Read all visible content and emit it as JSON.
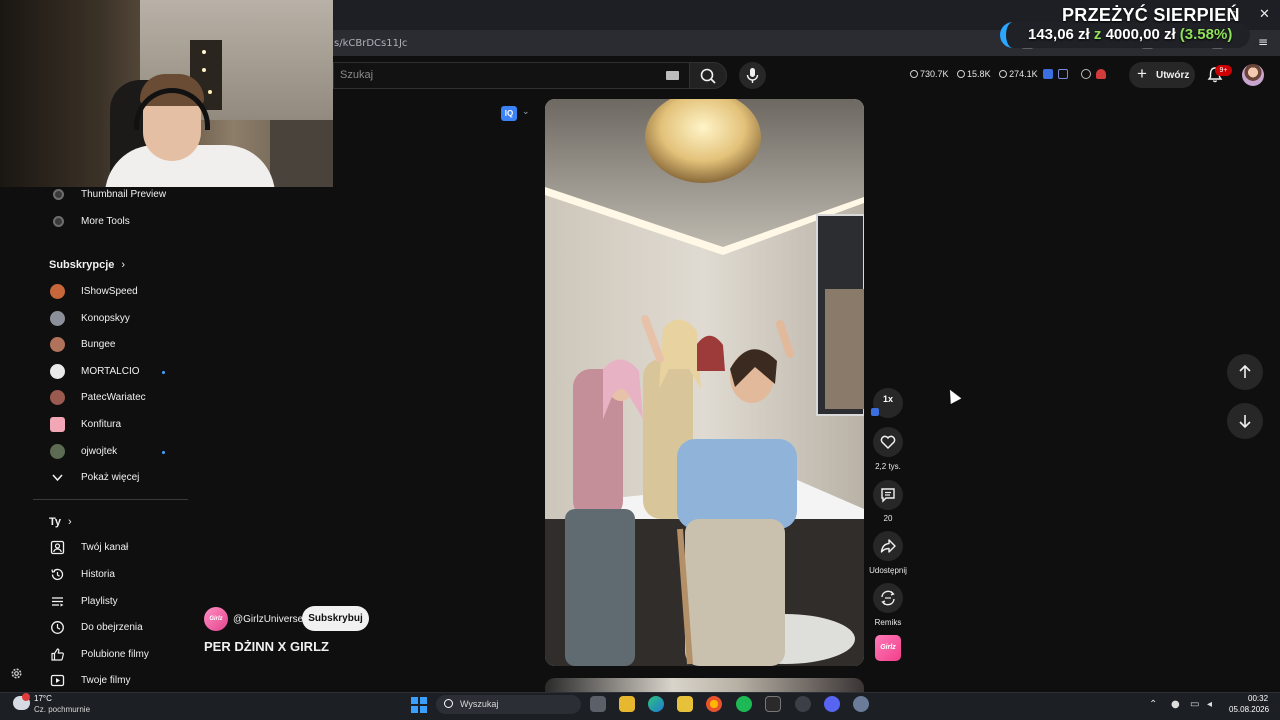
{
  "browser": {
    "url_fragment": "s/kCBrDCs11Jc",
    "minimize": "▢",
    "close": "✕"
  },
  "promo": {
    "title": "PRZEŻYĆ SIERPIEŃ",
    "amount": "143,06 zł",
    "connector": "z",
    "goal": "4000,00 zł",
    "percent": "(3.58%)"
  },
  "header": {
    "search_placeholder": "Szukaj",
    "stats": [
      "730.7K",
      "15.8K",
      "274.1K"
    ],
    "create_label": "Utwórz",
    "notification_count": "9+"
  },
  "sidebar": {
    "tools": [
      {
        "label": "Thumbnail Preview"
      },
      {
        "label": "More Tools"
      }
    ],
    "subscriptions_title": "Subskrypcje",
    "subscriptions": [
      {
        "label": "IShowSpeed",
        "color": "#c8663b",
        "new": false
      },
      {
        "label": "Konopskyy",
        "color": "#8a8f99",
        "new": false
      },
      {
        "label": "Bungee",
        "color": "#b0725a",
        "new": false
      },
      {
        "label": "MORTALCIO",
        "color": "#e9e9e9",
        "new": true
      },
      {
        "label": "PatecWariatec",
        "color": "#9b5a4f",
        "new": false
      },
      {
        "label": "Konfitura",
        "color": "#f2a7b7",
        "new": false
      },
      {
        "label": "ojwojtek",
        "color": "#5d6b52",
        "new": true
      }
    ],
    "show_more": "Pokaż więcej",
    "you_title": "Ty",
    "you_items": [
      {
        "label": "Twój kanał",
        "icon": "person-box-icon"
      },
      {
        "label": "Historia",
        "icon": "history-icon"
      },
      {
        "label": "Playlisty",
        "icon": "playlist-icon"
      },
      {
        "label": "Do obejrzenia",
        "icon": "clock-icon"
      },
      {
        "label": "Polubione filmy",
        "icon": "thumb-up-icon"
      },
      {
        "label": "Twoje filmy",
        "icon": "play-box-icon"
      }
    ]
  },
  "short": {
    "extension_badge": "IQ",
    "speed": "1x",
    "likes": "2,2 tys.",
    "comments": "20",
    "share_label": "Udostępnij",
    "remix_label": "Remiks",
    "remix_thumb": "Girlz",
    "channel": "@GirlzUniverse",
    "subscribe_label": "Subskrybuj",
    "title": "PER DŻINN X GIRLZ"
  },
  "taskbar": {
    "weather_temp": "17°C",
    "weather_desc": "Cz. pochmurnie",
    "search_label": "Wyszukaj",
    "time": "00:32",
    "date": "05.08.2026"
  },
  "colors": {
    "background": "#0f0f0f",
    "accent_blue": "#3ea6ff",
    "promo_green": "#8fe05b",
    "badge_red": "#cc0000"
  }
}
